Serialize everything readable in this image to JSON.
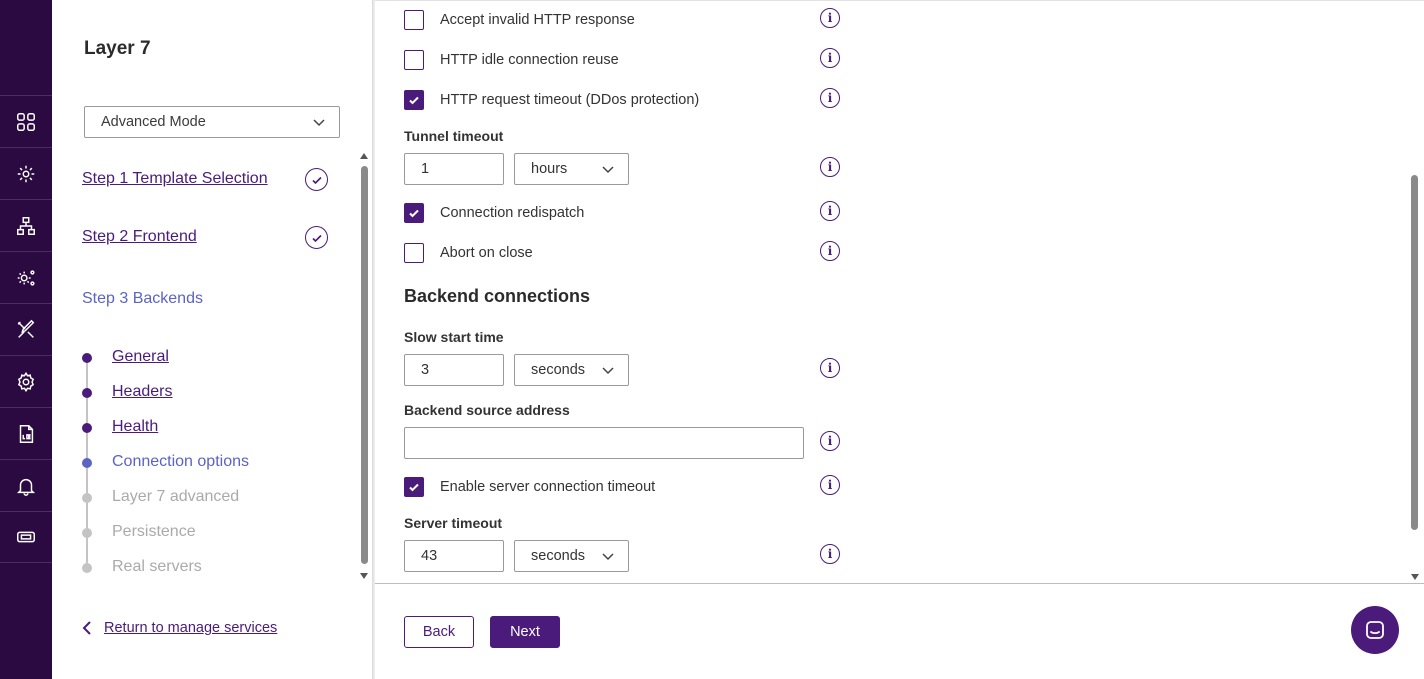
{
  "rail": {
    "items": [
      {
        "icon": "dashboard-grid-icon"
      },
      {
        "icon": "services-cog-icon"
      },
      {
        "icon": "network-topology-icon"
      },
      {
        "icon": "system-settings-icon"
      },
      {
        "icon": "tools-icon"
      },
      {
        "icon": "gear-icon"
      },
      {
        "icon": "log-file-icon"
      },
      {
        "icon": "notification-bell-icon"
      },
      {
        "icon": "ticket-icon"
      }
    ]
  },
  "sidebar": {
    "title": "Layer 7",
    "mode_select": "Advanced Mode",
    "steps": [
      {
        "label": "Step 1 Template Selection",
        "status": "complete"
      },
      {
        "label": "Step 2 Frontend",
        "status": "complete"
      },
      {
        "label": "Step 3 Backends",
        "status": "active"
      }
    ],
    "substeps": [
      {
        "label": "General",
        "status": "done"
      },
      {
        "label": "Headers",
        "status": "done"
      },
      {
        "label": "Health",
        "status": "done"
      },
      {
        "label": "Connection options",
        "status": "current"
      },
      {
        "label": "Layer 7 advanced",
        "status": "todo"
      },
      {
        "label": "Persistence",
        "status": "todo"
      },
      {
        "label": "Real servers",
        "status": "todo"
      }
    ],
    "return_link": "Return to manage services"
  },
  "form": {
    "accept_invalid": {
      "label": "Accept invalid HTTP response",
      "checked": false
    },
    "idle_reuse": {
      "label": "HTTP idle connection reuse",
      "checked": false
    },
    "request_timeout": {
      "label": "HTTP request timeout (DDos protection)",
      "checked": true
    },
    "tunnel_timeout": {
      "label": "Tunnel timeout",
      "value": "1",
      "unit": "hours"
    },
    "redispatch": {
      "label": "Connection redispatch",
      "checked": true
    },
    "abort_on_close": {
      "label": "Abort on close",
      "checked": false
    },
    "backend_section_title": "Backend connections",
    "slow_start": {
      "label": "Slow start time",
      "value": "3",
      "unit": "seconds"
    },
    "source_address": {
      "label": "Backend source address",
      "value": ""
    },
    "server_conn_timeout": {
      "label": "Enable server connection timeout",
      "checked": true
    },
    "server_timeout": {
      "label": "Server timeout",
      "value": "43",
      "unit": "seconds"
    }
  },
  "footer": {
    "back_label": "Back",
    "next_label": "Next"
  },
  "colors": {
    "brand": "#4a1b7a",
    "rail_bg": "#2a0a40",
    "active_step": "#5b63c4"
  }
}
